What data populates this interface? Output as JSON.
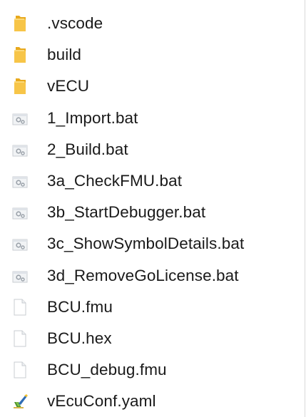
{
  "files": [
    {
      "name": ".vscode",
      "type": "folder",
      "icon": "folder-icon"
    },
    {
      "name": "build",
      "type": "folder",
      "icon": "folder-icon"
    },
    {
      "name": "vECU",
      "type": "folder",
      "icon": "folder-icon"
    },
    {
      "name": "1_Import.bat",
      "type": "batch",
      "icon": "batch-file-icon"
    },
    {
      "name": "2_Build.bat",
      "type": "batch",
      "icon": "batch-file-icon"
    },
    {
      "name": "3a_CheckFMU.bat",
      "type": "batch",
      "icon": "batch-file-icon"
    },
    {
      "name": "3b_StartDebugger.bat",
      "type": "batch",
      "icon": "batch-file-icon"
    },
    {
      "name": "3c_ShowSymbolDetails.bat",
      "type": "batch",
      "icon": "batch-file-icon"
    },
    {
      "name": "3d_RemoveGoLicense.bat",
      "type": "batch",
      "icon": "batch-file-icon"
    },
    {
      "name": "BCU.fmu",
      "type": "file",
      "icon": "blank-file-icon"
    },
    {
      "name": "BCU.hex",
      "type": "file",
      "icon": "blank-file-icon"
    },
    {
      "name": "BCU_debug.fmu",
      "type": "file",
      "icon": "blank-file-icon"
    },
    {
      "name": "vEcuConf.yaml",
      "type": "yaml",
      "icon": "yaml-file-icon"
    }
  ],
  "colors": {
    "folder": "#f7c548",
    "folder_dark": "#e8a91d",
    "text": "#1a1a1a"
  }
}
